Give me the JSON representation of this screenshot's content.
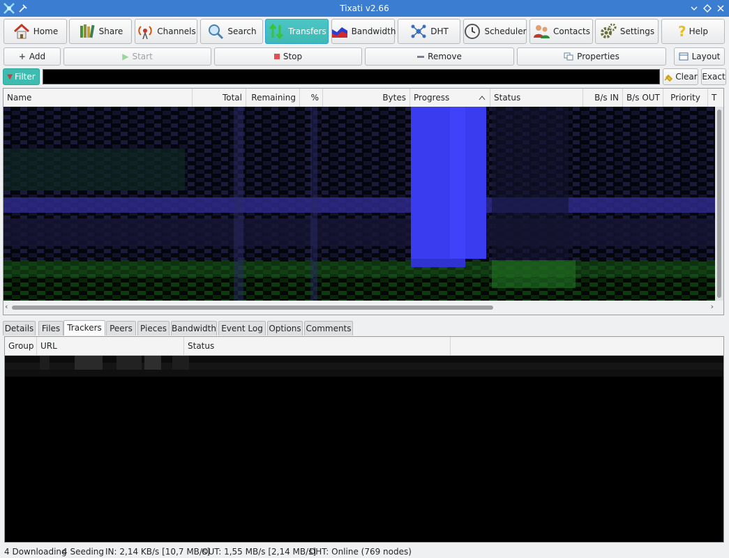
{
  "window": {
    "title": "Tixati v2.66"
  },
  "toolbar": {
    "home": "Home",
    "share": "Share",
    "channels": "Channels",
    "search": "Search",
    "transfers": "Transfers",
    "bandwidth": "Bandwidth",
    "dht": "DHT",
    "scheduler": "Scheduler",
    "contacts": "Contacts",
    "settings": "Settings",
    "help": "Help"
  },
  "actions": {
    "add": "Add",
    "start": "Start",
    "stop": "Stop",
    "remove": "Remove",
    "properties": "Properties",
    "layout": "Layout"
  },
  "filter": {
    "label": "Filter",
    "value": "",
    "clear": "Clear",
    "exact": "Exact"
  },
  "transfers_table": {
    "columns": [
      "Name",
      "Total",
      "Remaining",
      "%",
      "Bytes",
      "Progress",
      "Status",
      "B/s IN",
      "B/s OUT",
      "Priority",
      "T"
    ],
    "sort_column": "Progress"
  },
  "tabs": [
    "Details",
    "Files",
    "Trackers",
    "Peers",
    "Pieces",
    "Bandwidth",
    "Event Log",
    "Options",
    "Comments"
  ],
  "active_tab": "Trackers",
  "trackers_table": {
    "columns": [
      "Group",
      "URL",
      "Status"
    ]
  },
  "status": {
    "downloading": "4 Downloading",
    "seeding": "4 Seeding",
    "in": "IN: 2,14 KB/s [10,7 MB/s]",
    "out": "OUT: 1,55 MB/s [2,14 MB/s]",
    "dht": "DHT: Online (769 nodes)"
  },
  "colors": {
    "accent": "#3ebcaf",
    "titlebar": "#3b7ed1",
    "progress": "#3a3cf0",
    "download_text": "#2eaa3a"
  }
}
